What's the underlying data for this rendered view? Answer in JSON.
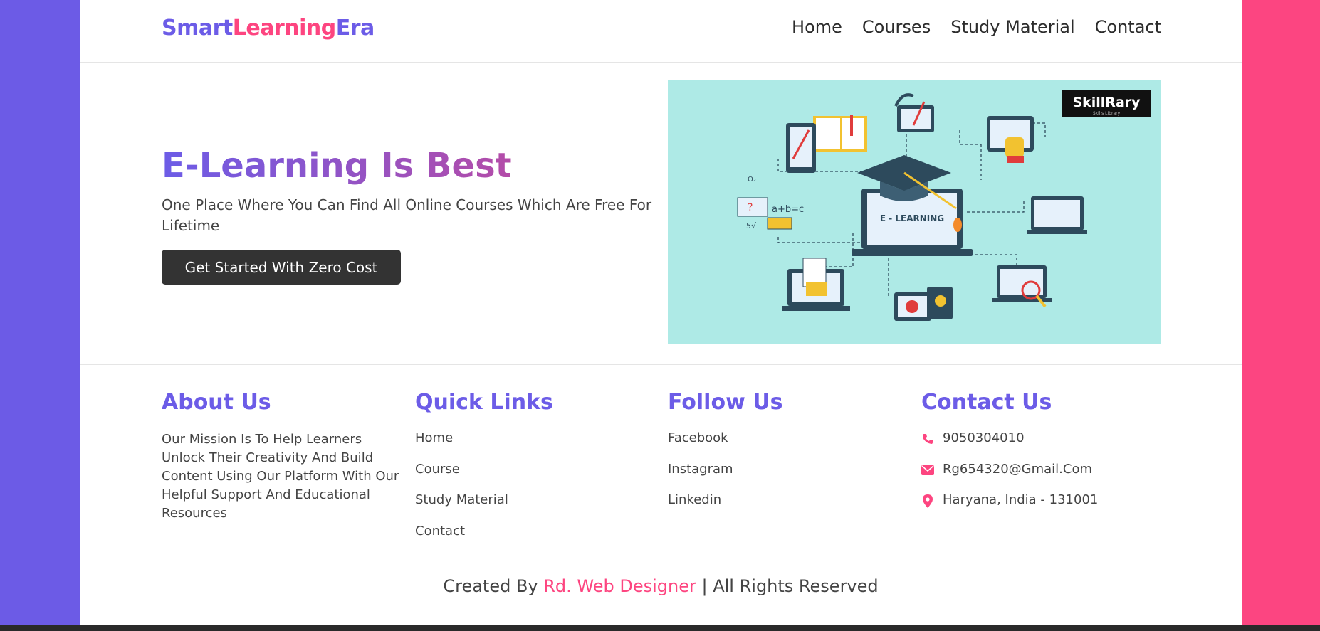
{
  "brand": {
    "part1": "Smart",
    "part2": "Learning",
    "part3": "Era"
  },
  "nav": [
    "Home",
    "Courses",
    "Study Material",
    "Contact"
  ],
  "hero": {
    "title": "E-Learning Is Best",
    "subtitle": "One Place Where You Can Find All Online Courses Which Are Free For Lifetime",
    "button": "Get Started With Zero Cost",
    "image": {
      "center_label": "E - LEARNING",
      "badge_main": "SkillRary",
      "badge_sub": "Skills Library",
      "icon": "e-learning-illustration"
    }
  },
  "footer": {
    "about": {
      "heading": "About Us",
      "text": "Our Mission Is To Help Learners Unlock Their Creativity And Build Content Using Our Platform With Our Helpful Support And Educational Resources"
    },
    "quick_links": {
      "heading": "Quick Links",
      "items": [
        "Home",
        "Course",
        "Study Material",
        "Contact"
      ]
    },
    "follow": {
      "heading": "Follow Us",
      "items": [
        "Facebook",
        "Instagram",
        "Linkedin"
      ]
    },
    "contact": {
      "heading": "Contact Us",
      "items": [
        {
          "icon": "phone-icon",
          "text": "9050304010"
        },
        {
          "icon": "envelope-icon",
          "text": "Rg654320@Gmail.Com"
        },
        {
          "icon": "map-pin-icon",
          "text": "Haryana, India - 131001"
        }
      ]
    },
    "copyright": {
      "prefix": "Created By ",
      "author": "Rd. Web Designer",
      "suffix": " | All Rights Reserved"
    }
  },
  "colors": {
    "primary": "#6c5ce7",
    "accent": "#fd4580",
    "dark_button": "#333333",
    "hero_image_bg": "#aeeae6"
  }
}
